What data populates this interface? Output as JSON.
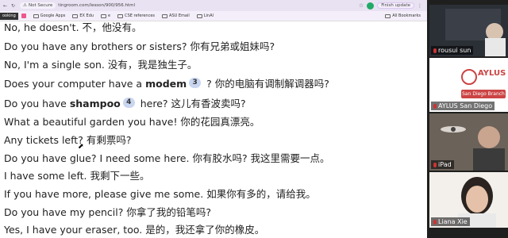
{
  "browser": {
    "topbar": {
      "security": "Not Secure",
      "url": "tingroom.com/lesson/900/956.html",
      "finish_update": "Finish update"
    },
    "bookmarks": [
      {
        "label": "ooking",
        "kind": "tag"
      },
      {
        "label": "Google Apps",
        "kind": "folder"
      },
      {
        "label": "EX Edu",
        "kind": "folder"
      },
      {
        "label": "e",
        "kind": "folder"
      },
      {
        "label": "CSE references",
        "kind": "folder"
      },
      {
        "label": "ASU Email",
        "kind": "folder"
      },
      {
        "label": "LinAI",
        "kind": "folder"
      }
    ],
    "all_bookmarks": "All Bookmarks"
  },
  "lesson": {
    "lines": [
      {
        "text": "No, he doesn't. 不，他没有。"
      },
      {
        "text": "Do you have any brothers or sisters? 你有兄弟或姐妹吗?"
      },
      {
        "text": "No, I'm a single son. 没有，我是独生子。"
      },
      {
        "before": "Does your computer have a ",
        "word": "modem",
        "note": "3",
        "after": " ? 你的电脑有调制解调器吗?"
      },
      {
        "before": "Do you have ",
        "word": "shampoo",
        "note": "4",
        "after": " here? 这儿有香波卖吗?"
      },
      {
        "text": "What a beautiful garden you have! 你的花园真漂亮。"
      },
      {
        "text": "Any tickets left? 有剩票吗?"
      },
      {
        "text": "Do you have glue? I need some here. 你有胶水吗? 我这里需要一点。"
      },
      {
        "text": "I have some left. 我剩下一些。"
      },
      {
        "text": "If you have more, please give me some. 如果你有多的，请给我。"
      },
      {
        "text": "Do you have my pencil? 你拿了我的铅笔吗?"
      },
      {
        "text": "Yes, I have your eraser, too. 是的，我还拿了你的橡皮。"
      }
    ]
  },
  "participants": [
    {
      "name": "rousui sun"
    },
    {
      "name": "AYLUS San Diego",
      "logo_text": "AYLUS",
      "branch": "San Diego Branch"
    },
    {
      "name": "iPad"
    },
    {
      "name": "Liana Xie"
    }
  ],
  "colors": {
    "topbar_bg": "#e9e2f3",
    "note_badge": "#c9d6f0",
    "aylus_red": "#c44"
  }
}
